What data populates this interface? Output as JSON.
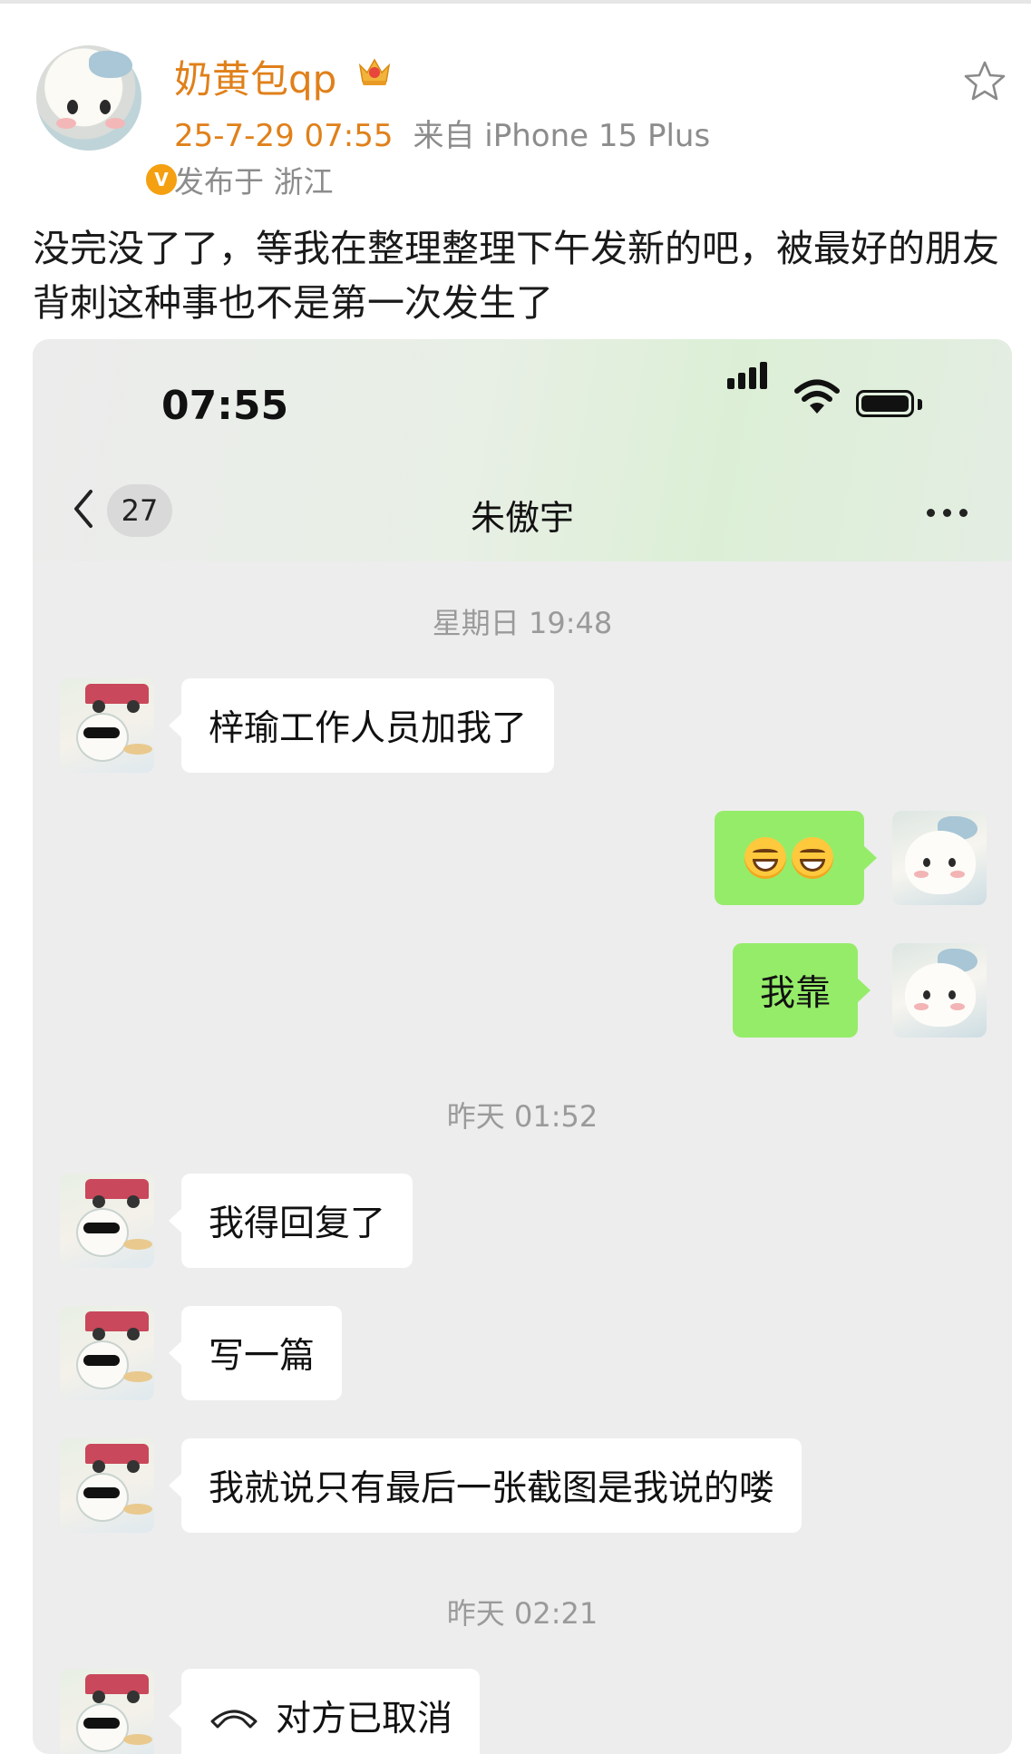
{
  "post": {
    "username": "奶黄包qp",
    "date": "25-7-29 07:55",
    "source": "来自 iPhone 15 Plus",
    "location": "发布于 浙江",
    "text": "没完没了了，等我在整理整理下午发新的吧，被最好的朋友背刺这种事也不是第一次发生了",
    "verified_badge": "V",
    "accent_color": "#e0801a",
    "icons": [
      "vip-crown-icon",
      "star-icon",
      "verified-icon"
    ]
  },
  "chat": {
    "status_time": "07:55",
    "back_count": "27",
    "title": "朱傲宇",
    "icons": [
      "signal-icon",
      "wifi-icon",
      "battery-icon",
      "back-chevron-icon",
      "more-icon",
      "call-cancelled-icon"
    ],
    "bubble_colors": {
      "friend": "#ffffff",
      "self": "#95ec69"
    },
    "timestamps": [
      "星期日 19:48",
      "昨天 01:52",
      "昨天 02:21"
    ],
    "messages": [
      {
        "from": "friend",
        "text": "梓瑜工作人员加我了"
      },
      {
        "from": "self",
        "emoji": "grinning-face x2"
      },
      {
        "from": "self",
        "text": "我靠"
      },
      {
        "from": "friend",
        "text": "我得回复了"
      },
      {
        "from": "friend",
        "text": "写一篇"
      },
      {
        "from": "friend",
        "text": "我就说只有最后一张截图是我说的喽"
      },
      {
        "from": "friend",
        "text": "对方已取消"
      }
    ]
  }
}
